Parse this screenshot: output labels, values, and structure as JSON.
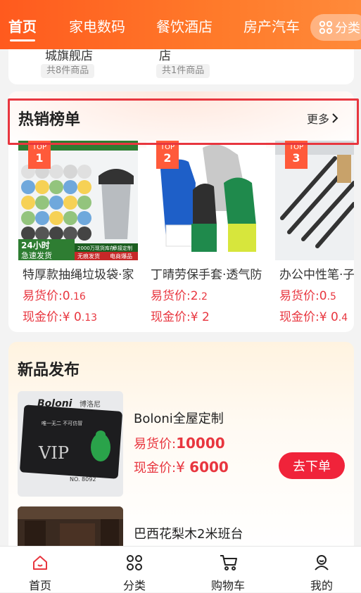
{
  "topnav": {
    "tabs": [
      "首页",
      "家电数码",
      "餐饮酒店",
      "房产汽车"
    ],
    "category_label": "分类",
    "colors": {
      "start": "#ff5a1e",
      "end": "#ff8a3a"
    }
  },
  "stores": [
    {
      "name": "城旗舰店",
      "count": "共8件商品"
    },
    {
      "name": "店",
      "count": "共1件商品"
    }
  ],
  "hot": {
    "title": "热销榜单",
    "more": "更多",
    "products": [
      {
        "rank_label": "TOP",
        "rank": "1",
        "name": "特厚款抽绳垃圾袋·家",
        "yh_label": "易货价:",
        "yh_int": "0",
        "yh_dec": ".16",
        "cash_label": "现金价:",
        "cash_currency": "¥",
        "cash_int": "0",
        "cash_dec": ".13",
        "banner_top": "24小时",
        "banner_mid": "急速发货",
        "tag1": "2000万现货库存",
        "tag2": "承接定制",
        "tag3": "无痕发货",
        "tag4": "电商爆品"
      },
      {
        "rank_label": "TOP",
        "rank": "2",
        "name": "丁晴劳保手套·透气防",
        "yh_label": "易货价:",
        "yh_int": "2",
        "yh_dec": ".2",
        "cash_label": "现金价:",
        "cash_currency": "¥",
        "cash_int": "2",
        "cash_dec": ""
      },
      {
        "rank_label": "TOP",
        "rank": "3",
        "name": "办公中性笔·子",
        "yh_label": "易货价:",
        "yh_int": "0",
        "yh_dec": ".5",
        "cash_label": "现金价:",
        "cash_currency": "¥",
        "cash_int": "0",
        "cash_dec": ".4"
      }
    ]
  },
  "new_products": {
    "title": "新品发布",
    "items": [
      {
        "name": "Boloni全屋定制",
        "yh_label": "易货价:",
        "yh_value": "10000",
        "cash_label": "现金价:",
        "cash_currency": "¥",
        "cash_value": "6000",
        "button": "去下单",
        "card_brand": "Boloni",
        "card_sub": "博洛尼",
        "card_vip": "VIP",
        "card_no": "NO. 8092",
        "card_slogan": "唯一无二   不可仿冒"
      },
      {
        "name": "巴西花梨木2米班台"
      }
    ]
  },
  "bottom_nav": [
    {
      "label": "首页",
      "icon": "home-icon",
      "active": true
    },
    {
      "label": "分类",
      "icon": "grid-icon",
      "active": false
    },
    {
      "label": "购物车",
      "icon": "cart-icon",
      "active": false
    },
    {
      "label": "我的",
      "icon": "user-icon",
      "active": false
    }
  ],
  "accent": "#e8363f"
}
